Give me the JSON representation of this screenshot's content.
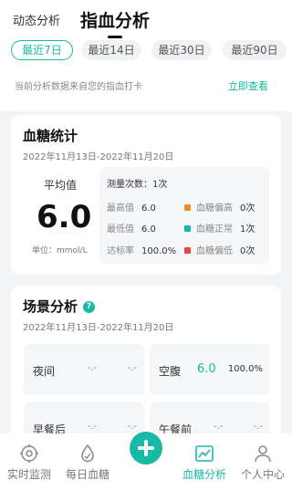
{
  "header": {
    "tab_dynamic": "动态分析",
    "tab_fingerstick": "指血分析"
  },
  "periods": {
    "p7": "最近7日",
    "p14": "最近14日",
    "p30": "最近30日",
    "p90": "最近90日",
    "selected": "最近7日"
  },
  "source": {
    "text": "当前分析数据来自您的指血打卡",
    "link": "立即查看"
  },
  "stats": {
    "title": "血糖统计",
    "date_range": "2022年11月13日-2022年11月20日",
    "avg_label": "平均值",
    "avg_value": "6.0",
    "unit": "单位：mmol/L",
    "count_label": "测量次数：",
    "count_value": "1次",
    "max_label": "最高值",
    "max_value": "6.0",
    "min_label": "最低值",
    "min_value": "6.0",
    "rate_label": "达标率",
    "rate_value": "100.0%",
    "high_label": "血糖偏高",
    "high_count": "0次",
    "high_color": "#f08a24",
    "normal_label": "血糖正常",
    "normal_count": "1次",
    "normal_color": "#18b9a5",
    "low_label": "血糖偏低",
    "low_count": "0次",
    "low_color": "#e8453c"
  },
  "scene": {
    "title": "场景分析",
    "date_range": "2022年11月13日-2022年11月20日",
    "help_icon": "?",
    "tiles": [
      {
        "name": "夜间",
        "a": "-.-",
        "b": "-.-"
      },
      {
        "name": "空腹",
        "a": "6.0",
        "b": "100.0%"
      },
      {
        "name": "早餐后",
        "a": "-.-",
        "b": "-.-"
      },
      {
        "name": "午餐前",
        "a": "-.-",
        "b": "-.-"
      }
    ]
  },
  "nav": {
    "realtime": "实时监测",
    "daily": "每日血糖",
    "analysis": "血糖分析",
    "profile": "个人中心",
    "accent": "#18b9a5"
  }
}
